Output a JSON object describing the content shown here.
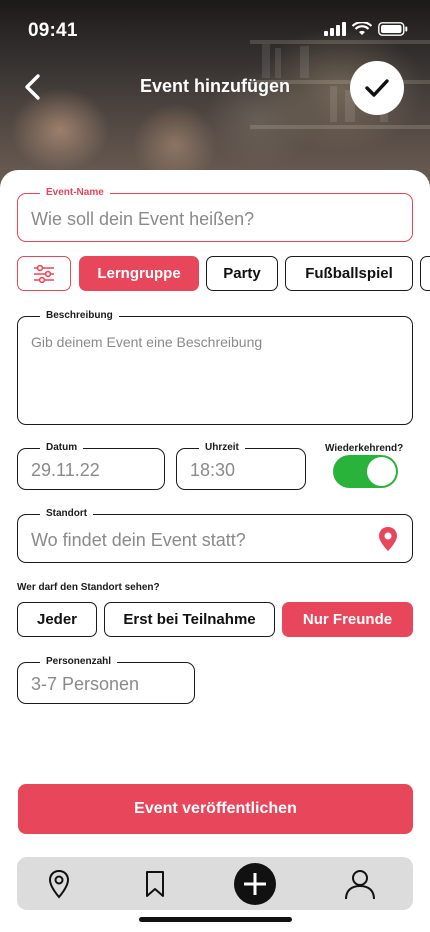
{
  "status_bar": {
    "time": "09:41"
  },
  "header": {
    "title": "Event hinzufügen"
  },
  "form": {
    "event_name": {
      "label": "Event-Name",
      "placeholder": "Wie soll dein Event heißen?"
    },
    "categories": [
      "Lerngruppe",
      "Party",
      "Fußballspiel"
    ],
    "selected_category": "Lerngruppe",
    "description": {
      "label": "Beschreibung",
      "placeholder": "Gib deinem Event eine Beschreibung"
    },
    "date": {
      "label": "Datum",
      "value": "29.11.22"
    },
    "time": {
      "label": "Uhrzeit",
      "value": "18:30"
    },
    "recurring": {
      "label": "Wiederkehrend?",
      "enabled": true
    },
    "location": {
      "label": "Standort",
      "placeholder": "Wo findet dein Event statt?"
    },
    "visibility": {
      "question": "Wer darf den Standort sehen?",
      "options": [
        "Jeder",
        "Erst bei Teilnahme",
        "Nur Freunde"
      ],
      "selected": "Nur Freunde"
    },
    "people": {
      "label": "Personenzahl",
      "placeholder": "3-7 Personen"
    }
  },
  "publish_button": {
    "label": "Event veröffentlichen"
  },
  "tabbar": {
    "items": [
      "map-pin-icon",
      "bookmark-icon",
      "add-icon",
      "profile-icon"
    ]
  },
  "colors": {
    "accent": "#e8475b",
    "toggle_on": "#29b33b",
    "tabbar": "#dcdcdc"
  }
}
